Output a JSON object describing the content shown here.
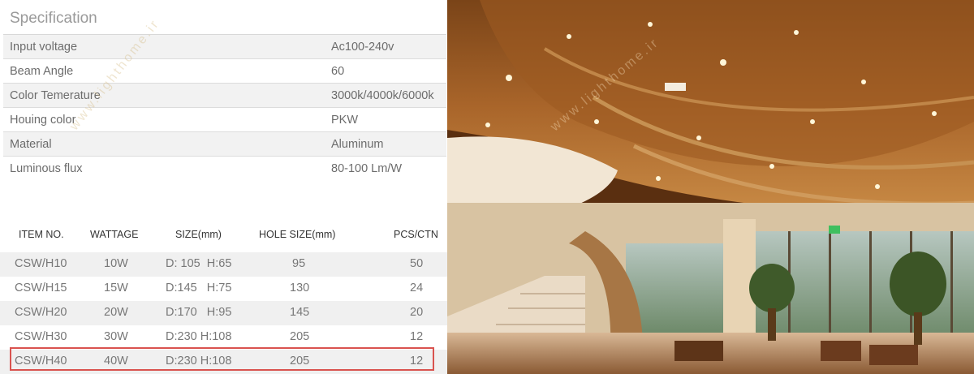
{
  "spec": {
    "title": "Specification",
    "rows": [
      {
        "label": "Input voltage",
        "value": "Ac100-240v"
      },
      {
        "label": "Beam Angle",
        "value": "60"
      },
      {
        "label": "Color Temerature",
        "value": "3000k/4000k/6000k"
      },
      {
        "label": "Houing color",
        "value": "PKW"
      },
      {
        "label": "Material",
        "value": "Aluminum"
      },
      {
        "label": "Luminous flux",
        "value": "80-100 Lm/W"
      }
    ]
  },
  "products": {
    "headers": [
      "ITEM NO.",
      "WATTAGE",
      "SIZE(mm)",
      "HOLE SIZE(mm)",
      "PCS/CTN"
    ],
    "rows": [
      [
        "CSW/H10",
        "10W",
        "D: 105  H:65",
        "95",
        "50"
      ],
      [
        "CSW/H15",
        "15W",
        "D:145   H:75",
        "130",
        "24"
      ],
      [
        "CSW/H20",
        "20W",
        "D:170   H:95",
        "145",
        "20"
      ],
      [
        "CSW/H30",
        "30W",
        "D:230 H:108",
        "205",
        "12"
      ],
      [
        "CSW/H40",
        "40W",
        "D:230 H:108",
        "205",
        "12"
      ]
    ]
  },
  "watermark": "www.lighthome.ir"
}
